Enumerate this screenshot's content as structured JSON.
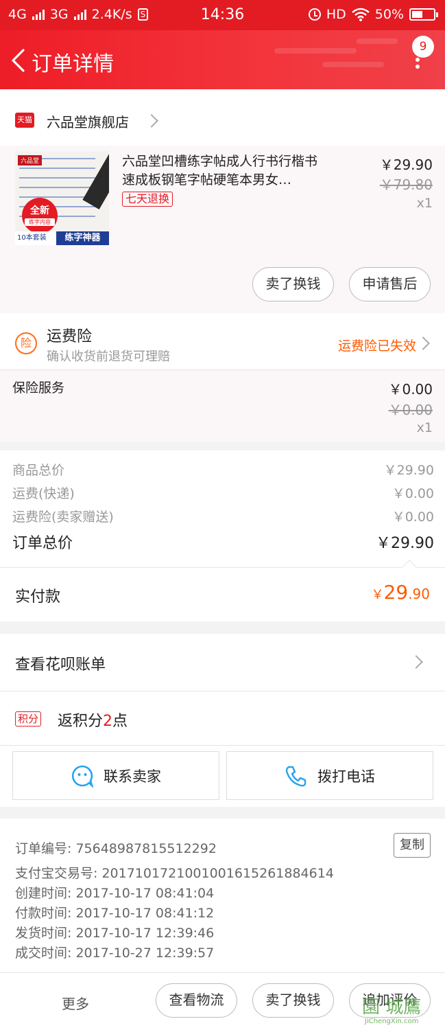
{
  "status_bar": {
    "network1": "4G",
    "network2": "3G",
    "speed": "2.4K/s",
    "s_icon": "S",
    "time": "14:36",
    "hd": "HD",
    "battery": "50%",
    "battery_level": 0.5
  },
  "nav": {
    "title": "订单详情",
    "badge_count": "9",
    "icons": [
      "back-arrow-icon",
      "more-icon"
    ]
  },
  "shop": {
    "logo_text": "天猫",
    "name": "六品堂旗舰店"
  },
  "product": {
    "thumb": {
      "logo": "六品堂",
      "circle_main": "全新",
      "circle_sub": "练字内容",
      "left_text": "10本套装",
      "right_text": "练字神器"
    },
    "title": "六品堂凹槽练字帖成人行书行楷书速成板钢笔字帖硬笔本男女…",
    "tag": "七天退换",
    "price": "￥29.90",
    "original_price": "￥79.80",
    "quantity": "x1",
    "buttons": [
      "卖了换钱",
      "申请售后"
    ]
  },
  "shipping_insurance": {
    "icon_text": "险",
    "title": "运费险",
    "subtitle": "确认收货前退货可理赔",
    "status": "运费险已失效"
  },
  "insurance_service": {
    "label": "保险服务",
    "price": "￥0.00",
    "original_price": "￥0.00",
    "quantity": "x1"
  },
  "summary": {
    "rows": [
      {
        "label": "商品总价",
        "value": "￥29.90"
      },
      {
        "label": "运费(快递)",
        "value": "￥0.00"
      },
      {
        "label": "运费险(卖家赠送)",
        "value": "￥0.00"
      }
    ],
    "total_label": "订单总价",
    "total_value": "￥29.90"
  },
  "payment": {
    "label": "实付款",
    "currency": "￥",
    "integer": "29",
    "decimal": ".90",
    "accent_color": "#ff5a00"
  },
  "huabei": {
    "label": "查看花呗账单"
  },
  "points": {
    "tag": "积分",
    "prefix": "返积分",
    "number": "2",
    "suffix": "点"
  },
  "contact": {
    "seller": "联系卖家",
    "phone": "拨打电话"
  },
  "order_info": {
    "order_no": "订单编号: 75648987815512292",
    "copy": "复制",
    "alipay_no": "支付宝交易号: 2017101721001001615261884614",
    "created": "创建时间:  2017-10-17 08:41:04",
    "paid": "付款时间:  2017-10-17 08:41:12",
    "shipped": "发货时间:  2017-10-17 12:39:46",
    "completed": "成交时间:  2017-10-27 12:39:57"
  },
  "bottom_bar": {
    "more": "更多",
    "buttons": [
      "查看物流",
      "卖了换钱",
      "追加评价"
    ]
  },
  "watermark": {
    "main": "園 城鷹",
    "sub": "JiChengXin.com"
  },
  "colors": {
    "brand_red": "#e31b23",
    "orange": "#ff5a00"
  }
}
